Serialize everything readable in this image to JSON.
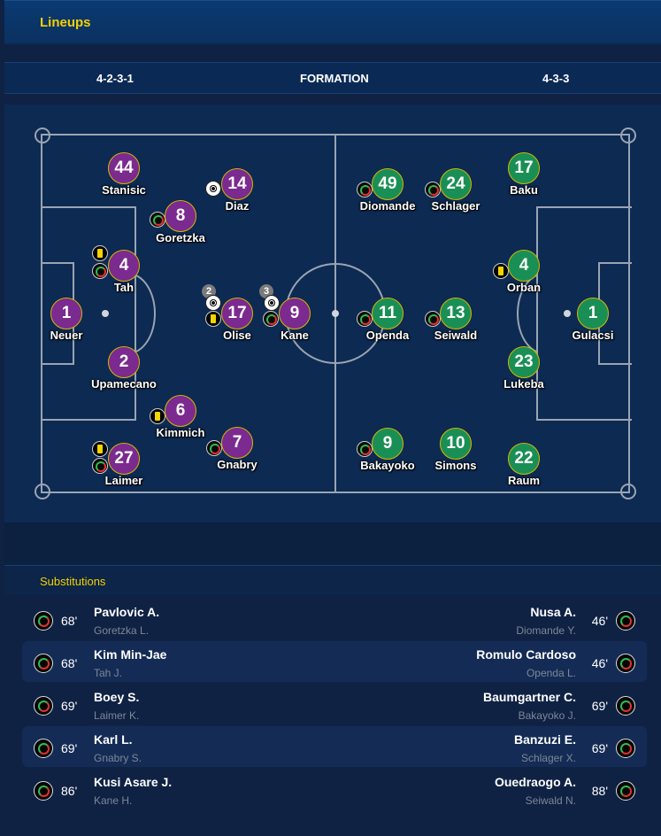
{
  "header": {
    "title": "Lineups"
  },
  "formation": {
    "home": "4-2-3-1",
    "label": "FORMATION",
    "away": "4-3-3"
  },
  "home_players": [
    {
      "number": "44",
      "name": "Stanisic"
    },
    {
      "number": "14",
      "name": "Diaz"
    },
    {
      "number": "8",
      "name": "Goretzka"
    },
    {
      "number": "4",
      "name": "Tah"
    },
    {
      "number": "1",
      "name": "Neuer"
    },
    {
      "number": "17",
      "name": "Olise"
    },
    {
      "number": "9",
      "name": "Kane"
    },
    {
      "number": "2",
      "name": "Upamecano"
    },
    {
      "number": "6",
      "name": "Kimmich"
    },
    {
      "number": "7",
      "name": "Gnabry"
    },
    {
      "number": "27",
      "name": "Laimer"
    }
  ],
  "away_players": [
    {
      "number": "49",
      "name": "Diomande"
    },
    {
      "number": "24",
      "name": "Schlager"
    },
    {
      "number": "17",
      "name": "Baku"
    },
    {
      "number": "4",
      "name": "Orban"
    },
    {
      "number": "11",
      "name": "Openda"
    },
    {
      "number": "13",
      "name": "Seiwald"
    },
    {
      "number": "1",
      "name": "Gulacsi"
    },
    {
      "number": "23",
      "name": "Lukeba"
    },
    {
      "number": "9",
      "name": "Bakayoko"
    },
    {
      "number": "10",
      "name": "Simons"
    },
    {
      "number": "22",
      "name": "Raum"
    }
  ],
  "goal_counts": {
    "olise": "2",
    "kane": "3"
  },
  "substitutions": {
    "title": "Substitutions",
    "rows": [
      {
        "home_minute": "68'",
        "home_in": "Pavlovic A.",
        "home_out": "Goretzka L.",
        "away_in": "Nusa A.",
        "away_out": "Diomande Y.",
        "away_minute": "46'"
      },
      {
        "home_minute": "68'",
        "home_in": "Kim Min-Jae",
        "home_out": "Tah J.",
        "away_in": "Romulo Cardoso",
        "away_out": "Openda L.",
        "away_minute": "46'"
      },
      {
        "home_minute": "69'",
        "home_in": "Boey S.",
        "home_out": "Laimer K.",
        "away_in": "Baumgartner C.",
        "away_out": "Bakayoko J.",
        "away_minute": "69'"
      },
      {
        "home_minute": "69'",
        "home_in": "Karl L.",
        "home_out": "Gnabry S.",
        "away_in": "Banzuzi E.",
        "away_out": "Schlager X.",
        "away_minute": "69'"
      },
      {
        "home_minute": "86'",
        "home_in": "Kusi Asare J.",
        "home_out": "Kane H.",
        "away_in": "Ouedraogo A.",
        "away_out": "Seiwald N.",
        "away_minute": "88'"
      }
    ]
  },
  "colors": {
    "home": "#7b2a8f",
    "away": "#1a8f55",
    "accent": "#f5d000"
  },
  "icons": {
    "sub": "substitution-icon",
    "yellow": "yellow-card-icon",
    "goal": "goal-ball-icon"
  }
}
